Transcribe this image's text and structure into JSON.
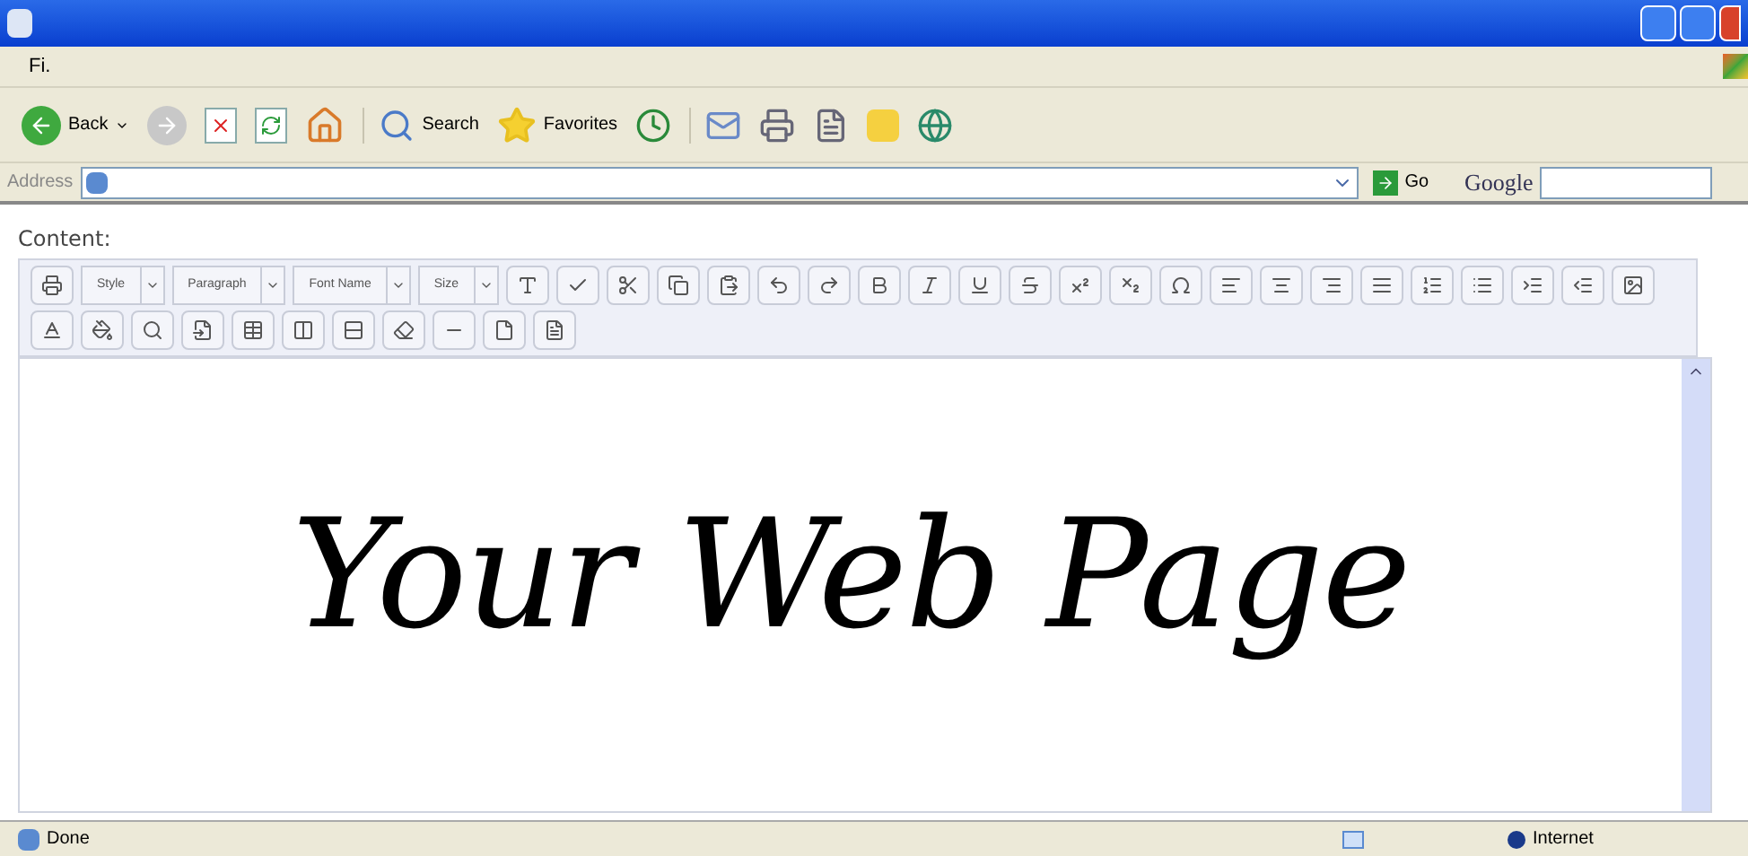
{
  "menu_bar": {
    "items": [
      "Fi."
    ]
  },
  "toolbar": {
    "back": "Back",
    "search": "Search",
    "favorites": "Favorites"
  },
  "address_bar": {
    "label": "Address",
    "go": "Go",
    "search_brand": "Google"
  },
  "editor": {
    "label": "Content:",
    "dropdowns": [
      "Style",
      "Paragraph",
      "Font Name",
      "Size"
    ],
    "content": "Your Web Page"
  },
  "status_bar": {
    "status": "Done",
    "zone": "Internet"
  }
}
